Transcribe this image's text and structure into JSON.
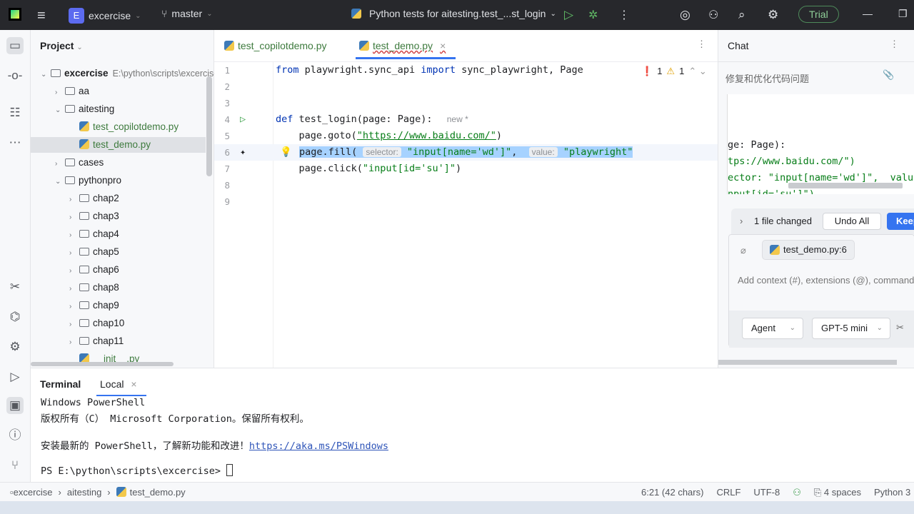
{
  "titlebar": {
    "project_badge": "E",
    "project": "excercise",
    "branch": "master",
    "run_config": "Python tests for aitesting.test_...st_login",
    "trial": "Trial"
  },
  "project_panel": {
    "title": "Project",
    "items": [
      {
        "label": "excercise",
        "path": "E:\\python\\scripts\\excercise",
        "kind": "folder",
        "level": 0,
        "open": true
      },
      {
        "label": "aa",
        "kind": "folder",
        "level": 1,
        "open": false
      },
      {
        "label": "aitesting",
        "kind": "folder",
        "level": 1,
        "open": true
      },
      {
        "label": "test_copilotdemo.py",
        "kind": "py",
        "level": 2
      },
      {
        "label": "test_demo.py",
        "kind": "py",
        "level": 2,
        "selected": true
      },
      {
        "label": "cases",
        "kind": "folder",
        "level": 1,
        "open": false
      },
      {
        "label": "pythonpro",
        "kind": "folder",
        "level": 1,
        "open": true
      },
      {
        "label": "chap2",
        "kind": "folder",
        "level": 2,
        "open": false
      },
      {
        "label": "chap3",
        "kind": "folder",
        "level": 2,
        "open": false
      },
      {
        "label": "chap4",
        "kind": "folder",
        "level": 2,
        "open": false
      },
      {
        "label": "chap5",
        "kind": "folder",
        "level": 2,
        "open": false
      },
      {
        "label": "chap6",
        "kind": "folder",
        "level": 2,
        "open": false
      },
      {
        "label": "chap8",
        "kind": "folder",
        "level": 2,
        "open": false
      },
      {
        "label": "chap9",
        "kind": "folder",
        "level": 2,
        "open": false
      },
      {
        "label": "chap10",
        "kind": "folder",
        "level": 2,
        "open": false
      },
      {
        "label": "chap11",
        "kind": "folder",
        "level": 2,
        "open": false
      },
      {
        "label": "__init__.py",
        "kind": "py",
        "level": 2
      }
    ]
  },
  "editor": {
    "tabs": [
      {
        "label": "test_copilotdemo.py"
      },
      {
        "label": "test_demo.py",
        "active": true
      }
    ],
    "errors": "1",
    "warnings": "1",
    "lines": {
      "n1": "1",
      "n2": "2",
      "n3": "3",
      "n4": "4",
      "n5": "5",
      "n6": "6",
      "n7": "7",
      "n8": "8",
      "n9": "9",
      "l1a": "from",
      "l1b": " playwright.sync_api ",
      "l1c": "import",
      "l1d": " sync_playwright, Page",
      "l4a": "def",
      "l4b": " test_login(page: Page):",
      "l4hint": "new *",
      "l5a": "    page.goto(",
      "l5b": "\"https://www.baidu.com/\"",
      "l5c": ")",
      "l6a": "page.fill(",
      "l6sel": "selector:",
      "l6b": "\"input[name='wd']\"",
      "l6c": ", ",
      "l6val": "value:",
      "l6d": "\"playwright\"",
      "l7a": "    page.click(",
      "l7b": "\"input[id='su']\"",
      "l7c": ")"
    }
  },
  "chat": {
    "title": "Chat",
    "session": "修复和优化代码问题",
    "preview": [
      "ge: Page):",
      "tps://www.baidu.com/\")",
      "ector: \"input[name='wd']\",  value: '",
      "nput[id='su']\")"
    ],
    "files_changed": "1 file changed",
    "undo_all": "Undo All",
    "keep": "Keep",
    "context_file": "test_demo.py:6",
    "input_placeholder": "Add context (#), extensions (@), commands",
    "mode": "Agent",
    "model": "GPT-5 mini"
  },
  "terminal": {
    "title": "Terminal",
    "tab": "Local",
    "lines": [
      "Windows PowerShell",
      "版权所有（C） Microsoft Corporation。保留所有权利。",
      "",
      "安装最新的 PowerShell，了解新功能和改进！"
    ],
    "link": "https://aka.ms/PSWindows",
    "prompt": "PS E:\\python\\scripts\\excercise> "
  },
  "status": {
    "crumbs": [
      "excercise",
      "aitesting",
      "test_demo.py"
    ],
    "position": "6:21 (42 chars)",
    "line_sep": "CRLF",
    "encoding": "UTF-8",
    "indent": "4 spaces",
    "interpreter": "Python 3"
  }
}
